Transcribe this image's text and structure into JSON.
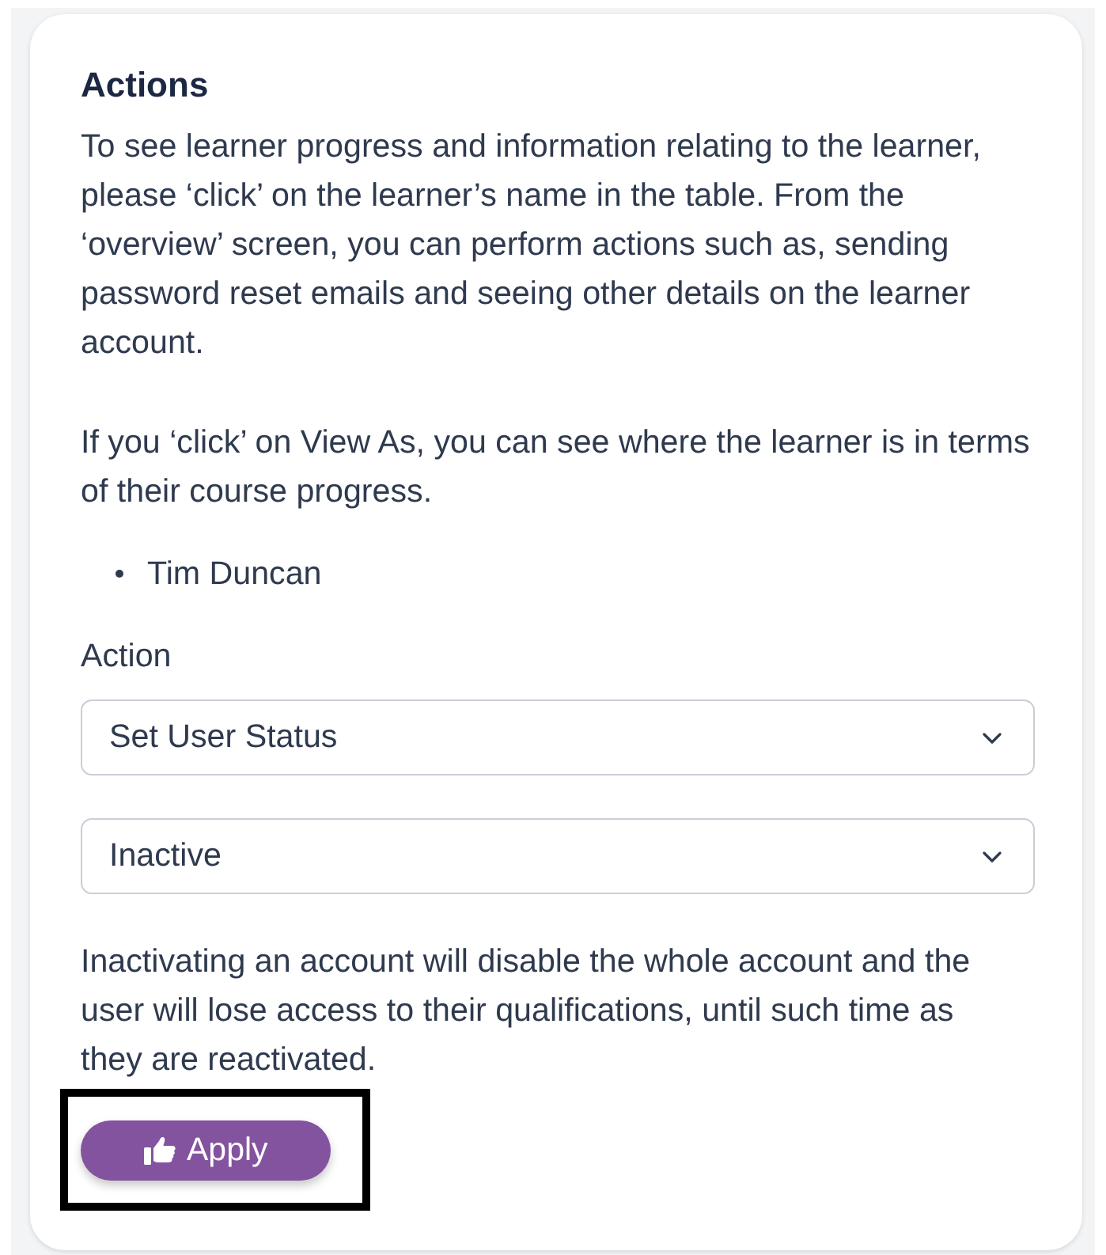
{
  "card": {
    "title": "Actions",
    "paragraphs": [
      {
        "lines": [
          "To see learner progress and information relating to the learner,",
          "please ‘click’ on the learner’s name in the table. From the",
          "‘overview’ screen, you can perform actions such as, sending",
          "password reset emails and seeing other details on the learner",
          "account."
        ]
      },
      {
        "lines": [
          "If you ‘click’ on View As, you can see where the learner is in terms",
          "of their course progress."
        ]
      }
    ],
    "learners": [
      "Tim Duncan"
    ],
    "action_label": "Action",
    "selects": [
      {
        "value": "Set User Status"
      },
      {
        "value": "Inactive"
      }
    ],
    "note": {
      "lines": [
        "Inactivating an account will disable the whole account and the",
        "user will lose access to their qualifications, until such time as",
        "they are reactivated."
      ]
    },
    "apply_button": {
      "label": "Apply",
      "highlighted": true
    }
  }
}
